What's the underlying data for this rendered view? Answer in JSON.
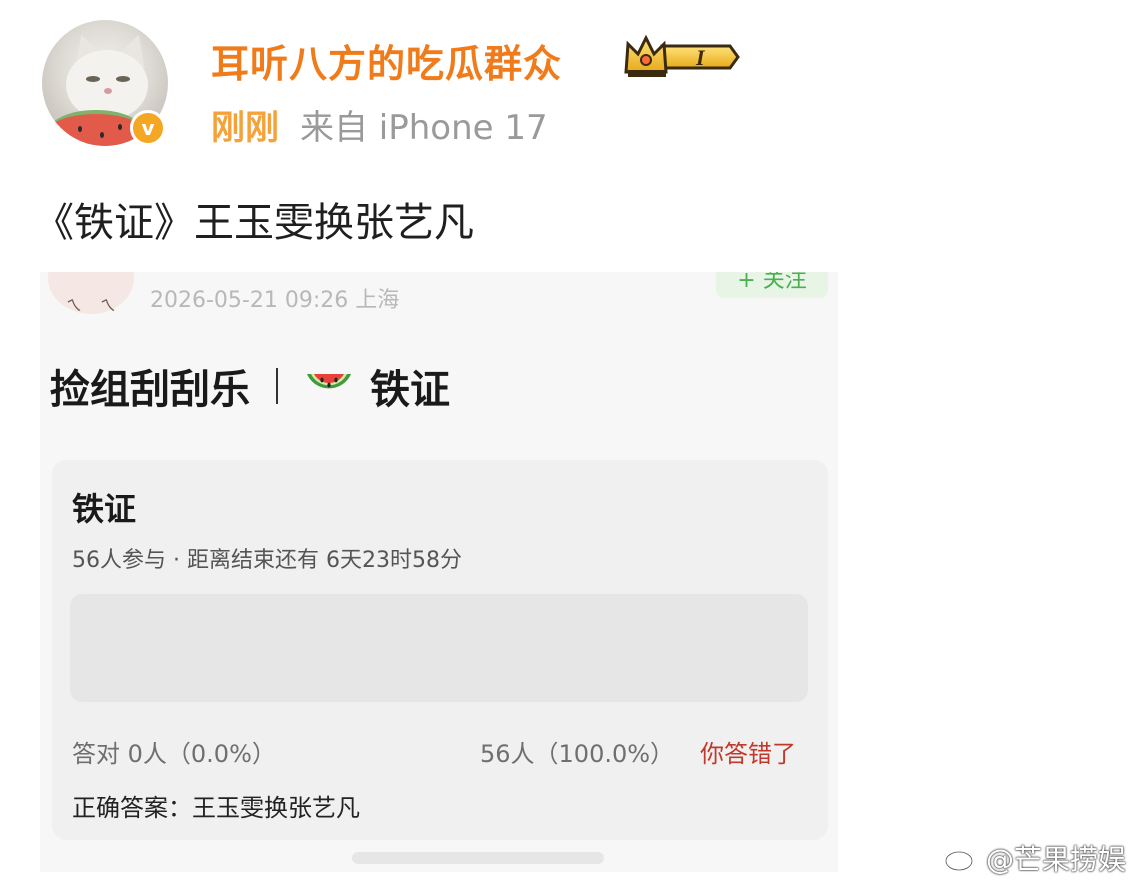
{
  "post": {
    "username": "耳听八方的吃瓜群众",
    "level_badge": "I",
    "verified_mark": "v",
    "time": "刚刚",
    "source": "来自 iPhone 17",
    "text": "《铁证》王玉雯换张艺凡"
  },
  "screenshot": {
    "date_location": "2026-05-21 09:26 上海",
    "follow_label": "+ 关注",
    "title_left": "捡组刮刮乐",
    "title_right": "铁证",
    "title_icon": "watermelon-icon",
    "quiz": {
      "title": "铁证",
      "subtitle": "56人参与 · 距离结束还有 6天23时58分",
      "correct_stat": "答对  0人（0.0%）",
      "wrong_stat": "56人（100.0%）",
      "result": "你答错了",
      "answer": "正确答案：王玉雯换张艺凡"
    }
  },
  "watermark": "@芒果捞娱",
  "colors": {
    "username": "#f07b1a",
    "time": "#f5a23a",
    "source": "#9a9a9a",
    "verified": "#f5a623",
    "wrong": "#c0392b"
  }
}
